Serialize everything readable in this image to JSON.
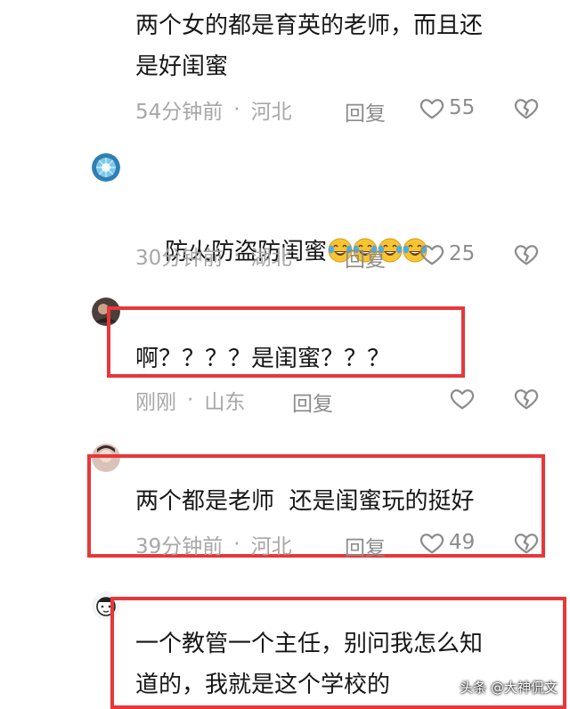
{
  "comments": [
    {
      "text": "两个女的都是育英的老师，而且还\n是好闺蜜",
      "time": "54分钟前",
      "location": "河北",
      "reply_label": "回复",
      "likes": "55"
    },
    {
      "text": "防火防盗防闺蜜",
      "emoji_count": 4,
      "time": "30分钟前",
      "location": "湖北",
      "reply_label": "回复",
      "likes": "25"
    },
    {
      "text": "啊？？？？是闺蜜？？？",
      "time": "刚刚",
      "location": "山东",
      "reply_label": "回复",
      "likes": ""
    },
    {
      "text": "两个都是老师  还是闺蜜玩的挺好",
      "time": "39分钟前",
      "location": "河北",
      "reply_label": "回复",
      "likes": "49"
    },
    {
      "text": "一个教管一个主任，别问我怎么知\n道的，我就是这个学校的"
    }
  ],
  "watermark": "头条 @大神侃文",
  "colors": {
    "highlight_box": "#e8373a",
    "meta_text": "#a7a7a7",
    "icon_stroke": "#8c8c8c"
  }
}
